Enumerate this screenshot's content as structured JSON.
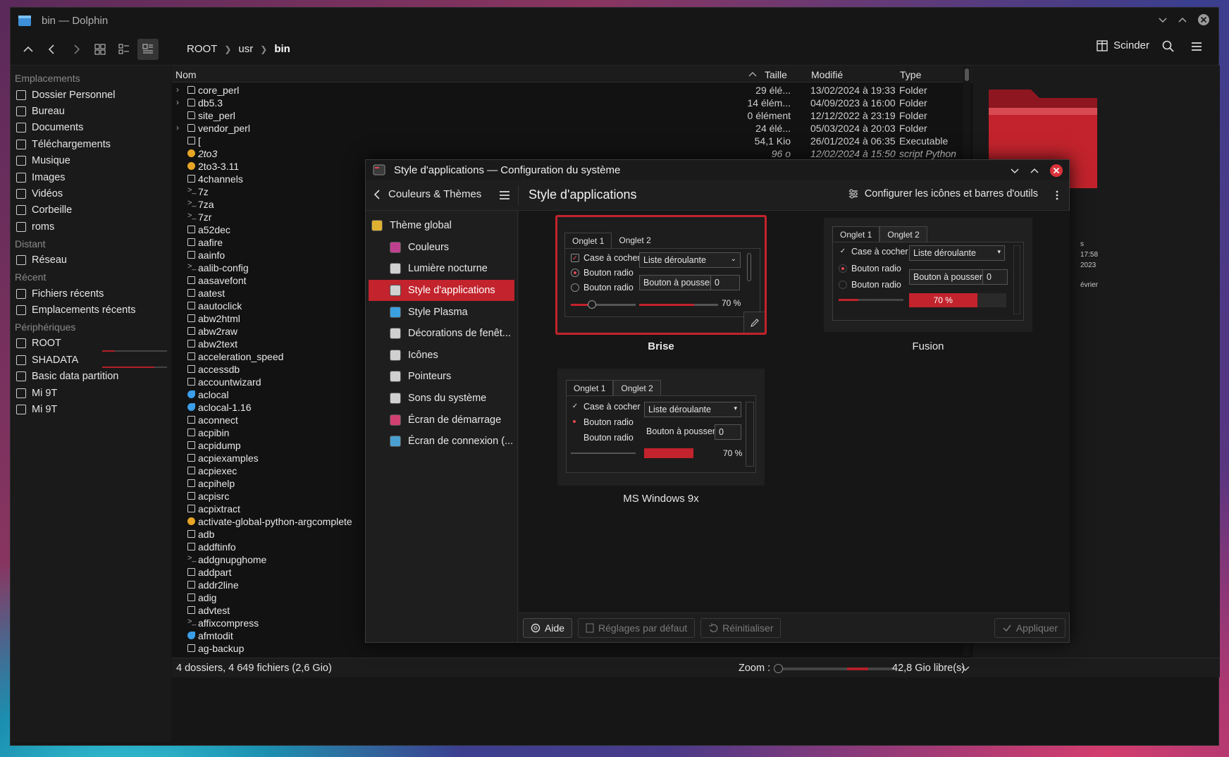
{
  "dolphin": {
    "title": "bin — Dolphin",
    "breadcrumb": [
      "ROOT",
      "usr",
      "bin"
    ],
    "split_label": "Scinder",
    "columns": {
      "name": "Nom",
      "size": "Taille",
      "modified": "Modifié",
      "type": "Type"
    },
    "status_text": "4 dossiers, 4 649 fichiers (2,6 Gio)",
    "zoom_label": "Zoom :",
    "free_space": "42,8 Gio libre(s)",
    "preview_fragments": [
      "s",
      "17:58",
      "2023",
      "évrier"
    ]
  },
  "sidebar": {
    "sections": [
      {
        "title": "Emplacements",
        "items": [
          {
            "label": "Dossier Personnel",
            "icon": "home-icon"
          },
          {
            "label": "Bureau",
            "icon": "desktop-icon"
          },
          {
            "label": "Documents",
            "icon": "documents-icon"
          },
          {
            "label": "Téléchargements",
            "icon": "download-icon"
          },
          {
            "label": "Musique",
            "icon": "music-icon"
          },
          {
            "label": "Images",
            "icon": "image-icon"
          },
          {
            "label": "Vidéos",
            "icon": "video-icon"
          },
          {
            "label": "Corbeille",
            "icon": "trash-icon"
          },
          {
            "label": "roms",
            "icon": "folder-icon"
          }
        ]
      },
      {
        "title": "Distant",
        "items": [
          {
            "label": "Réseau",
            "icon": "network-icon"
          }
        ]
      },
      {
        "title": "Récent",
        "items": [
          {
            "label": "Fichiers récents",
            "icon": "recent-files-icon"
          },
          {
            "label": "Emplacements récents",
            "icon": "recent-places-icon"
          }
        ]
      },
      {
        "title": "Périphériques",
        "items": [
          {
            "label": "ROOT",
            "icon": "drive-icon",
            "usage": 0.2
          },
          {
            "label": "SHADATA",
            "icon": "drive-icon",
            "usage": 0.8
          },
          {
            "label": "Basic data partition",
            "icon": "drive-icon"
          },
          {
            "label": "Mi 9T",
            "icon": "phone-icon"
          },
          {
            "label": "Mi 9T",
            "icon": "phone-icon"
          }
        ]
      }
    ]
  },
  "files": [
    {
      "name": "core_perl",
      "size": "29 élé...",
      "modified": "13/02/2024 à 19:33",
      "type": "Folder",
      "kind": "folder",
      "expand": true
    },
    {
      "name": "db5.3",
      "size": "14 élém...",
      "modified": "04/09/2023 à 16:00",
      "type": "Folder",
      "kind": "folder",
      "expand": true
    },
    {
      "name": "site_perl",
      "size": "0 élément",
      "modified": "12/12/2022 à 23:19",
      "type": "Folder",
      "kind": "folder",
      "expand": false
    },
    {
      "name": "vendor_perl",
      "size": "24 élé...",
      "modified": "05/03/2024 à 20:03",
      "type": "Folder",
      "kind": "folder",
      "expand": true
    },
    {
      "name": "[",
      "size": "54,1 Kio",
      "modified": "26/01/2024 à 06:35",
      "type": "Executable",
      "kind": "exe"
    },
    {
      "name": "2to3",
      "size": "96 o",
      "modified": "12/02/2024 à 15:50",
      "type": "script Python 3",
      "kind": "py",
      "italic": true
    },
    {
      "name": "2to3-3.11",
      "kind": "py"
    },
    {
      "name": "4channels",
      "kind": "exe"
    },
    {
      "name": "7z",
      "kind": "sh"
    },
    {
      "name": "7za",
      "kind": "sh"
    },
    {
      "name": "7zr",
      "kind": "sh"
    },
    {
      "name": "a52dec",
      "kind": "exe"
    },
    {
      "name": "aafire",
      "kind": "exe"
    },
    {
      "name": "aainfo",
      "kind": "exe"
    },
    {
      "name": "aalib-config",
      "kind": "sh"
    },
    {
      "name": "aasavefont",
      "kind": "exe"
    },
    {
      "name": "aatest",
      "kind": "exe"
    },
    {
      "name": "aautoclick",
      "kind": "exe"
    },
    {
      "name": "abw2html",
      "kind": "exe"
    },
    {
      "name": "abw2raw",
      "kind": "exe"
    },
    {
      "name": "abw2text",
      "kind": "exe"
    },
    {
      "name": "acceleration_speed",
      "kind": "exe"
    },
    {
      "name": "accessdb",
      "kind": "exe"
    },
    {
      "name": "accountwizard",
      "kind": "exe"
    },
    {
      "name": "aclocal",
      "kind": "perl"
    },
    {
      "name": "aclocal-1.16",
      "kind": "perl"
    },
    {
      "name": "aconnect",
      "kind": "exe"
    },
    {
      "name": "acpibin",
      "kind": "exe"
    },
    {
      "name": "acpidump",
      "kind": "exe"
    },
    {
      "name": "acpiexamples",
      "kind": "exe"
    },
    {
      "name": "acpiexec",
      "kind": "exe"
    },
    {
      "name": "acpihelp",
      "kind": "exe"
    },
    {
      "name": "acpisrc",
      "kind": "exe"
    },
    {
      "name": "acpixtract",
      "kind": "exe"
    },
    {
      "name": "activate-global-python-argcomplete",
      "kind": "py"
    },
    {
      "name": "adb",
      "kind": "exe"
    },
    {
      "name": "addftinfo",
      "kind": "exe"
    },
    {
      "name": "addgnupghome",
      "kind": "sh"
    },
    {
      "name": "addpart",
      "kind": "exe"
    },
    {
      "name": "addr2line",
      "kind": "exe"
    },
    {
      "name": "adig",
      "kind": "exe"
    },
    {
      "name": "advtest",
      "kind": "exe"
    },
    {
      "name": "affixcompress",
      "kind": "sh"
    },
    {
      "name": "afmtodit",
      "kind": "perl"
    },
    {
      "name": "ag-backup",
      "kind": "exe"
    }
  ],
  "settings": {
    "title": "Style d'applications — Configuration du système",
    "back_label": "Couleurs & Thèmes",
    "page_title": "Style d'applications",
    "configure_label": "Configurer les icônes et barres d'outils",
    "nav": [
      {
        "label": "Thème global",
        "level": 0,
        "color": "#e0b030"
      },
      {
        "label": "Couleurs",
        "level": 1,
        "color": "#c04090"
      },
      {
        "label": "Lumière nocturne",
        "level": 1,
        "color": "#d0d0d0"
      },
      {
        "label": "Style d'applications",
        "level": 1,
        "color": "#d0d0d0",
        "selected": true
      },
      {
        "label": "Style Plasma",
        "level": 1,
        "color": "#3aa0e0"
      },
      {
        "label": "Décorations de fenêt...",
        "level": 1,
        "color": "#d0d0d0"
      },
      {
        "label": "Icônes",
        "level": 1,
        "color": "#d0d0d0"
      },
      {
        "label": "Pointeurs",
        "level": 1,
        "color": "#d0d0d0"
      },
      {
        "label": "Sons du système",
        "level": 1,
        "color": "#d0d0d0"
      },
      {
        "label": "Écran de démarrage",
        "level": 1,
        "color": "#d04070"
      },
      {
        "label": "Écran de connexion (...",
        "level": 1,
        "color": "#4aa0d0"
      }
    ],
    "widget_text": {
      "tab1": "Onglet 1",
      "tab2": "Onglet 2",
      "checkbox": "Case à cocher",
      "radio": "Bouton radio",
      "dropdown": "Liste déroulante",
      "push": "Bouton à pousser",
      "spin": "0",
      "progress": "70 %"
    },
    "styles": [
      {
        "name": "Brise",
        "selected": true
      },
      {
        "name": "Fusion"
      },
      {
        "name": "MS Windows 9x"
      }
    ],
    "footer": {
      "help": "Aide",
      "defaults": "Réglages par défaut",
      "reset": "Réinitialiser",
      "apply": "Appliquer"
    }
  },
  "colors": {
    "accent": "#c2232c",
    "background": "#161616"
  }
}
